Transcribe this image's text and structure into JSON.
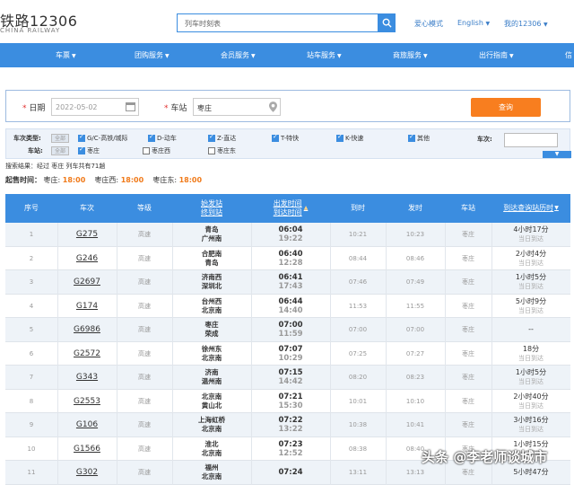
{
  "header": {
    "logo_text": "铁路12306",
    "logo_sub": "CHINA RAILWAY",
    "search_value": "列车时刻表",
    "links": [
      "爱心模式",
      "English",
      "我的12306"
    ]
  },
  "nav": [
    "车票",
    "团购服务",
    "会员服务",
    "站车服务",
    "商旅服务",
    "出行指南",
    "信"
  ],
  "query": {
    "date_label": "日期",
    "date_value": "2022-05-02",
    "station_label": "车站",
    "station_value": "枣庄",
    "submit_label": "查询"
  },
  "filters": {
    "type_label": "车次类型:",
    "all_label": "全部",
    "types": [
      "G/C-高铁/城际",
      "D-动车",
      "Z-直达",
      "T-特快",
      "K-快速",
      "其他"
    ],
    "station_label": "车站:",
    "stations": [
      "枣庄",
      "枣庄西",
      "枣庄东"
    ],
    "trainno_label": "车次:"
  },
  "result_text": "搜索结果：经过 枣庄 列车共有71趟",
  "presale": {
    "label": "起售时间：",
    "items": [
      {
        "station": "枣庄:",
        "time": "18:00"
      },
      {
        "station": "枣庄西:",
        "time": "18:00"
      },
      {
        "station": "枣庄东:",
        "time": "18:00"
      }
    ]
  },
  "table": {
    "headers": [
      "序号",
      "车次",
      "等级",
      "始发站\n终到站",
      "出发时间\n到达时间",
      "到时",
      "发时",
      "车站",
      "到达查询站历时"
    ],
    "rows": [
      {
        "no": "1",
        "train": "G275",
        "grade": "高速",
        "from": "青岛",
        "to": "广州南",
        "dep": "06:04",
        "arr": "19:22",
        "arrive": "10:21",
        "depart": "10:23",
        "station": "枣庄",
        "dur": "4小时17分",
        "day": "当日到达"
      },
      {
        "no": "2",
        "train": "G246",
        "grade": "高速",
        "from": "合肥南",
        "to": "青岛",
        "dep": "06:40",
        "arr": "12:28",
        "arrive": "08:44",
        "depart": "08:46",
        "station": "枣庄",
        "dur": "2小时4分",
        "day": "当日到达"
      },
      {
        "no": "3",
        "train": "G2697",
        "grade": "高速",
        "from": "济南西",
        "to": "深圳北",
        "dep": "06:41",
        "arr": "17:43",
        "arrive": "07:46",
        "depart": "07:49",
        "station": "枣庄",
        "dur": "1小时5分",
        "day": "当日到达"
      },
      {
        "no": "4",
        "train": "G174",
        "grade": "高速",
        "from": "台州西",
        "to": "北京南",
        "dep": "06:44",
        "arr": "14:40",
        "arrive": "11:53",
        "depart": "11:55",
        "station": "枣庄",
        "dur": "5小时9分",
        "day": "当日到达"
      },
      {
        "no": "5",
        "train": "G6986",
        "grade": "高速",
        "from": "枣庄",
        "to": "荣成",
        "dep": "07:00",
        "arr": "11:59",
        "arrive": "07:00",
        "depart": "07:00",
        "station": "枣庄",
        "dur": "--",
        "day": ""
      },
      {
        "no": "6",
        "train": "G2572",
        "grade": "高速",
        "from": "徐州东",
        "to": "北京南",
        "dep": "07:07",
        "arr": "10:29",
        "arrive": "07:25",
        "depart": "07:27",
        "station": "枣庄",
        "dur": "18分",
        "day": "当日到达"
      },
      {
        "no": "7",
        "train": "G343",
        "grade": "高速",
        "from": "济南",
        "to": "温州南",
        "dep": "07:15",
        "arr": "14:42",
        "arrive": "08:20",
        "depart": "08:23",
        "station": "枣庄",
        "dur": "1小时5分",
        "day": "当日到达"
      },
      {
        "no": "8",
        "train": "G2553",
        "grade": "高速",
        "from": "北京南",
        "to": "黄山北",
        "dep": "07:21",
        "arr": "15:30",
        "arrive": "10:01",
        "depart": "10:10",
        "station": "枣庄",
        "dur": "2小时40分",
        "day": "当日到达"
      },
      {
        "no": "9",
        "train": "G106",
        "grade": "高速",
        "from": "上海虹桥",
        "to": "北京南",
        "dep": "07:22",
        "arr": "13:22",
        "arrive": "10:38",
        "depart": "10:41",
        "station": "枣庄",
        "dur": "3小时16分",
        "day": "当日到达"
      },
      {
        "no": "10",
        "train": "G1566",
        "grade": "高速",
        "from": "淮北",
        "to": "北京南",
        "dep": "07:23",
        "arr": "12:52",
        "arrive": "08:38",
        "depart": "08:40",
        "station": "枣庄",
        "dur": "1小时15分",
        "day": "当日到达"
      },
      {
        "no": "11",
        "train": "G302",
        "grade": "高速",
        "from": "福州",
        "to": "北京南",
        "dep": "07:24",
        "arr": "",
        "arrive": "13:11",
        "depart": "13:13",
        "station": "枣庄",
        "dur": "5小时47分",
        "day": ""
      }
    ]
  },
  "watermark": "头条 @李老师谈城市"
}
